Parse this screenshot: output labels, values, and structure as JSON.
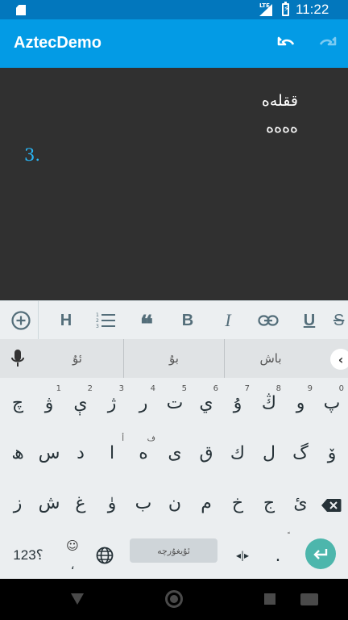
{
  "status_bar": {
    "network_label": "LTE",
    "time": "11:22"
  },
  "app_bar": {
    "title": "AztecDemo",
    "undo_icon": "undo-icon",
    "redo_icon": "redo-icon"
  },
  "editor": {
    "lines": [
      "ققلەە",
      "ەەەە"
    ],
    "list_number": "3."
  },
  "format_toolbar": {
    "add_icon": "add-circle-icon",
    "heading": "H",
    "list_icon": "ordered-list-icon",
    "quote": "❝",
    "bold": "B",
    "italic": "I",
    "link_icon": "link-icon",
    "underline": "U",
    "strikethrough": "S"
  },
  "suggestions": [
    "ئۇ",
    "بۇ",
    "باش"
  ],
  "keyboard": {
    "rows": [
      [
        {
          "label": "چ",
          "hint": ""
        },
        {
          "label": "ۋ",
          "hint": "1"
        },
        {
          "label": "ې",
          "hint": "2"
        },
        {
          "label": "ژ",
          "hint": "3"
        },
        {
          "label": "ر",
          "hint": "4"
        },
        {
          "label": "ت",
          "hint": "5"
        },
        {
          "label": "ي",
          "hint": "6"
        },
        {
          "label": "ۇ",
          "hint": "7"
        },
        {
          "label": "ڭ",
          "hint": "8"
        },
        {
          "label": "و",
          "hint": "9"
        },
        {
          "label": "پ",
          "hint": "0"
        }
      ],
      [
        {
          "label": "ھ",
          "hint": ""
        },
        {
          "label": "س",
          "hint": ""
        },
        {
          "label": "د",
          "hint": ""
        },
        {
          "label": "ا",
          "hint": "أ"
        },
        {
          "label": "ە",
          "hint": "ف"
        },
        {
          "label": "ى",
          "hint": ""
        },
        {
          "label": "ق",
          "hint": ""
        },
        {
          "label": "ك",
          "hint": ""
        },
        {
          "label": "ل",
          "hint": ""
        },
        {
          "label": "گ",
          "hint": ""
        },
        {
          "label": "ۆ",
          "hint": ""
        }
      ],
      [
        {
          "label": "ز",
          "hint": ""
        },
        {
          "label": "ش",
          "hint": ""
        },
        {
          "label": "غ",
          "hint": ""
        },
        {
          "label": "ۈ",
          "hint": ""
        },
        {
          "label": "ب",
          "hint": ""
        },
        {
          "label": "ن",
          "hint": ""
        },
        {
          "label": "م",
          "hint": ""
        },
        {
          "label": "خ",
          "hint": ""
        },
        {
          "label": "ج",
          "hint": ""
        },
        {
          "label": "ئ",
          "hint": ""
        }
      ]
    ],
    "numbers_key": "؟123",
    "emoji_key": "☺",
    "emoji_sub": "،",
    "globe_icon": "globe-icon",
    "space_label": "ئۇيغۇرچە",
    "cursor_key": "◂|▸",
    "period_key": ".",
    "period_hint": "ً",
    "enter_icon": "enter-icon",
    "backspace_icon": "backspace-icon"
  },
  "nav_bar": {
    "back_icon": "back-triangle-icon",
    "home_icon": "home-circle-icon",
    "recents_icon": "recents-square-icon",
    "keyboard_icon": "keyboard-icon"
  },
  "colors": {
    "status_bar": "#0277BD",
    "app_bar": "#039BE5",
    "editor_bg": "#303030",
    "list_number": "#29B6F6",
    "enter_key": "#4DB6AC"
  }
}
